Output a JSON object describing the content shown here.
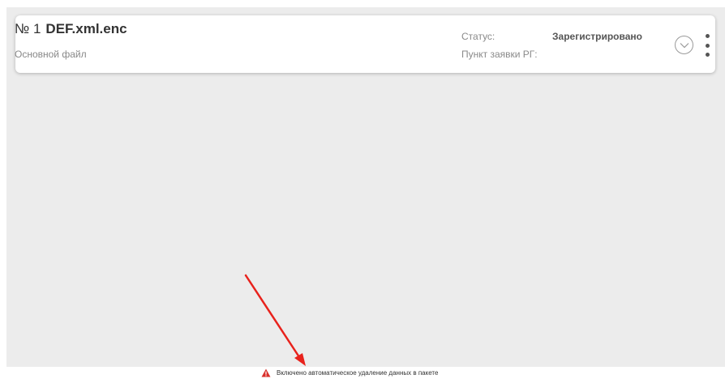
{
  "file_card": {
    "number": "№ 1",
    "name": "DEF.xml.enc",
    "type": "Основной файл",
    "status_label": "Статус:",
    "status_value": "Зарегистрировано",
    "point_label": "Пункт заявки РГ:",
    "point_value": ""
  },
  "footer": {
    "warning_text": "Включено автоматическое удаление данных в пакете"
  },
  "icons": {
    "expand": "chevron-down-icon",
    "more": "more-vertical-icon",
    "warning": "warning-triangle-icon"
  },
  "colors": {
    "panel_background": "#ececec",
    "card_background": "#ffffff",
    "warning_icon": "#d9302b",
    "annotation_arrow": "#e8221c"
  }
}
